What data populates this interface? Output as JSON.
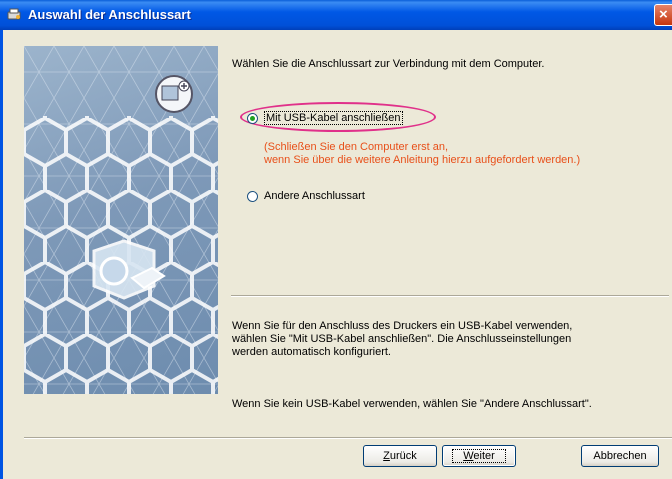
{
  "window": {
    "title": "Auswahl der Anschlussart",
    "icon": "printer-setup-icon",
    "close_icon": "close-icon"
  },
  "main": {
    "intro": "Wählen Sie die Anschlussart zur Verbindung mit dem Computer.",
    "options": [
      {
        "label": "Mit USB-Kabel anschließen",
        "checked": true
      },
      {
        "label": "Andere Anschlussart",
        "checked": false
      }
    ],
    "note_line1": "(Schließen Sie den Computer erst an,",
    "note_line2": "wenn Sie über die weitere Anleitung hierzu aufgefordert werden.)",
    "info_line1": "Wenn Sie für den Anschluss des Druckers ein USB-Kabel verwenden,",
    "info_line2": "wählen Sie \"Mit USB-Kabel anschließen\". Die Anschlusseinstellungen",
    "info_line3": "werden automatisch konfiguriert.",
    "info2": "Wenn Sie kein USB-Kabel verwenden, wählen Sie \"Andere Anschlussart\"."
  },
  "buttons": {
    "back_prefix": "",
    "back_mnemonic": "Z",
    "back_rest": "urück",
    "next_mnemonic": "W",
    "next_rest": "eiter",
    "cancel": "Abbrechen"
  },
  "colors": {
    "titlebar": "#0054e3",
    "note_text": "#e8501a",
    "highlight_ellipse": "#e0308a",
    "dialog_bg": "#ece9d8"
  }
}
